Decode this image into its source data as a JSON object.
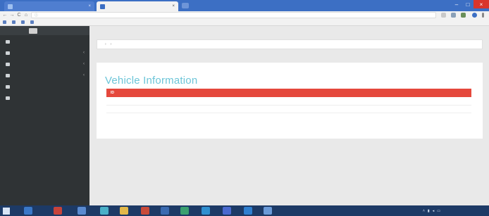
{
  "browser": {
    "tabs": [
      {
        "title": "",
        "close": "×"
      },
      {
        "title": "",
        "close": "×"
      }
    ],
    "address": "",
    "nav": {
      "back": "←",
      "forward": "→",
      "reload": "C",
      "home": "⌂"
    },
    "window_controls": {
      "minimize": "–",
      "maximize": "□",
      "close": "×"
    },
    "bookmarks": [
      "",
      "",
      "",
      ""
    ]
  },
  "sidebar": {
    "items": [
      {
        "label": "",
        "chevron": ""
      },
      {
        "label": "",
        "chevron": "‹"
      },
      {
        "label": "",
        "chevron": "‹"
      },
      {
        "label": "",
        "chevron": "‹"
      },
      {
        "label": "",
        "chevron": ""
      },
      {
        "label": "",
        "chevron": ""
      }
    ]
  },
  "breadcrumb": {
    "items": [
      "",
      "",
      ""
    ],
    "separator": "›"
  },
  "panel": {
    "title": "Vehicle Information",
    "table": {
      "headers": [
        "ID",
        "",
        "",
        "",
        ""
      ],
      "rows": [
        [
          "",
          "",
          "",
          "",
          ""
        ],
        [
          "",
          "",
          "",
          "",
          ""
        ]
      ]
    }
  },
  "taskbar": {
    "clock": ""
  },
  "colors": {
    "table_header": "#e5483c",
    "title": "#6cc5d8",
    "sidebar": "#2f3335",
    "tabstrip": "#3c6fc4"
  }
}
